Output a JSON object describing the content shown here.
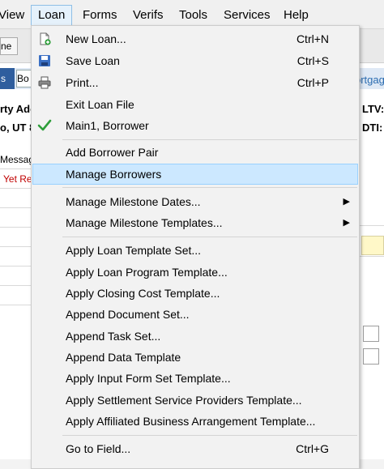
{
  "menubar": {
    "items": [
      {
        "label": "View"
      },
      {
        "label": "Loan"
      },
      {
        "label": "Forms"
      },
      {
        "label": "Verifs"
      },
      {
        "label": "Tools"
      },
      {
        "label": "Services"
      },
      {
        "label": "Help"
      }
    ]
  },
  "background": {
    "toolbar_ghost": "ne",
    "tab_dark": "s",
    "tab_light": "Bo",
    "right_link": "ortgag",
    "left_address_1": "rty Adc",
    "left_address_2": "o, UT 8",
    "left_message": "Messag",
    "left_red": "Yet Re",
    "ltv_label": "LTV:",
    "dti_label": "DTI:"
  },
  "loan_menu": {
    "items": [
      {
        "label": "New Loan...",
        "shortcut": "Ctrl+N",
        "icon": "new-loan-icon"
      },
      {
        "label": "Save Loan",
        "shortcut": "Ctrl+S",
        "icon": "save-icon"
      },
      {
        "label": "Print...",
        "shortcut": "Ctrl+P",
        "icon": "printer-icon"
      },
      {
        "label": "Exit Loan File",
        "shortcut": ""
      },
      {
        "label": "Main1, Borrower",
        "shortcut": "",
        "icon": "checkmark-icon"
      },
      {
        "label": "Add Borrower Pair",
        "shortcut": ""
      },
      {
        "label": "Manage Borrowers",
        "shortcut": "",
        "highlighted": true
      },
      {
        "label": "Manage Milestone Dates...",
        "shortcut": "",
        "submenu": true
      },
      {
        "label": "Manage Milestone Templates...",
        "shortcut": "",
        "submenu": true
      },
      {
        "label": "Apply Loan Template Set...",
        "shortcut": ""
      },
      {
        "label": "Apply Loan Program Template...",
        "shortcut": ""
      },
      {
        "label": "Apply Closing Cost Template...",
        "shortcut": ""
      },
      {
        "label": "Append Document Set...",
        "shortcut": ""
      },
      {
        "label": "Append Task Set...",
        "shortcut": ""
      },
      {
        "label": "Append Data Template",
        "shortcut": ""
      },
      {
        "label": "Apply Input Form Set Template...",
        "shortcut": ""
      },
      {
        "label": "Apply Settlement Service Providers Template...",
        "shortcut": ""
      },
      {
        "label": "Apply Affiliated Business Arrangement Template...",
        "shortcut": ""
      },
      {
        "label": "Go to Field...",
        "shortcut": "Ctrl+G"
      }
    ],
    "submenu_arrow": "▶"
  },
  "colors": {
    "highlight_bg": "#cce8ff",
    "highlight_border": "#99d1ff",
    "menu_bg": "#f2f2f2",
    "check_green": "#2e9e3a",
    "save_blue": "#3a6fc4"
  }
}
